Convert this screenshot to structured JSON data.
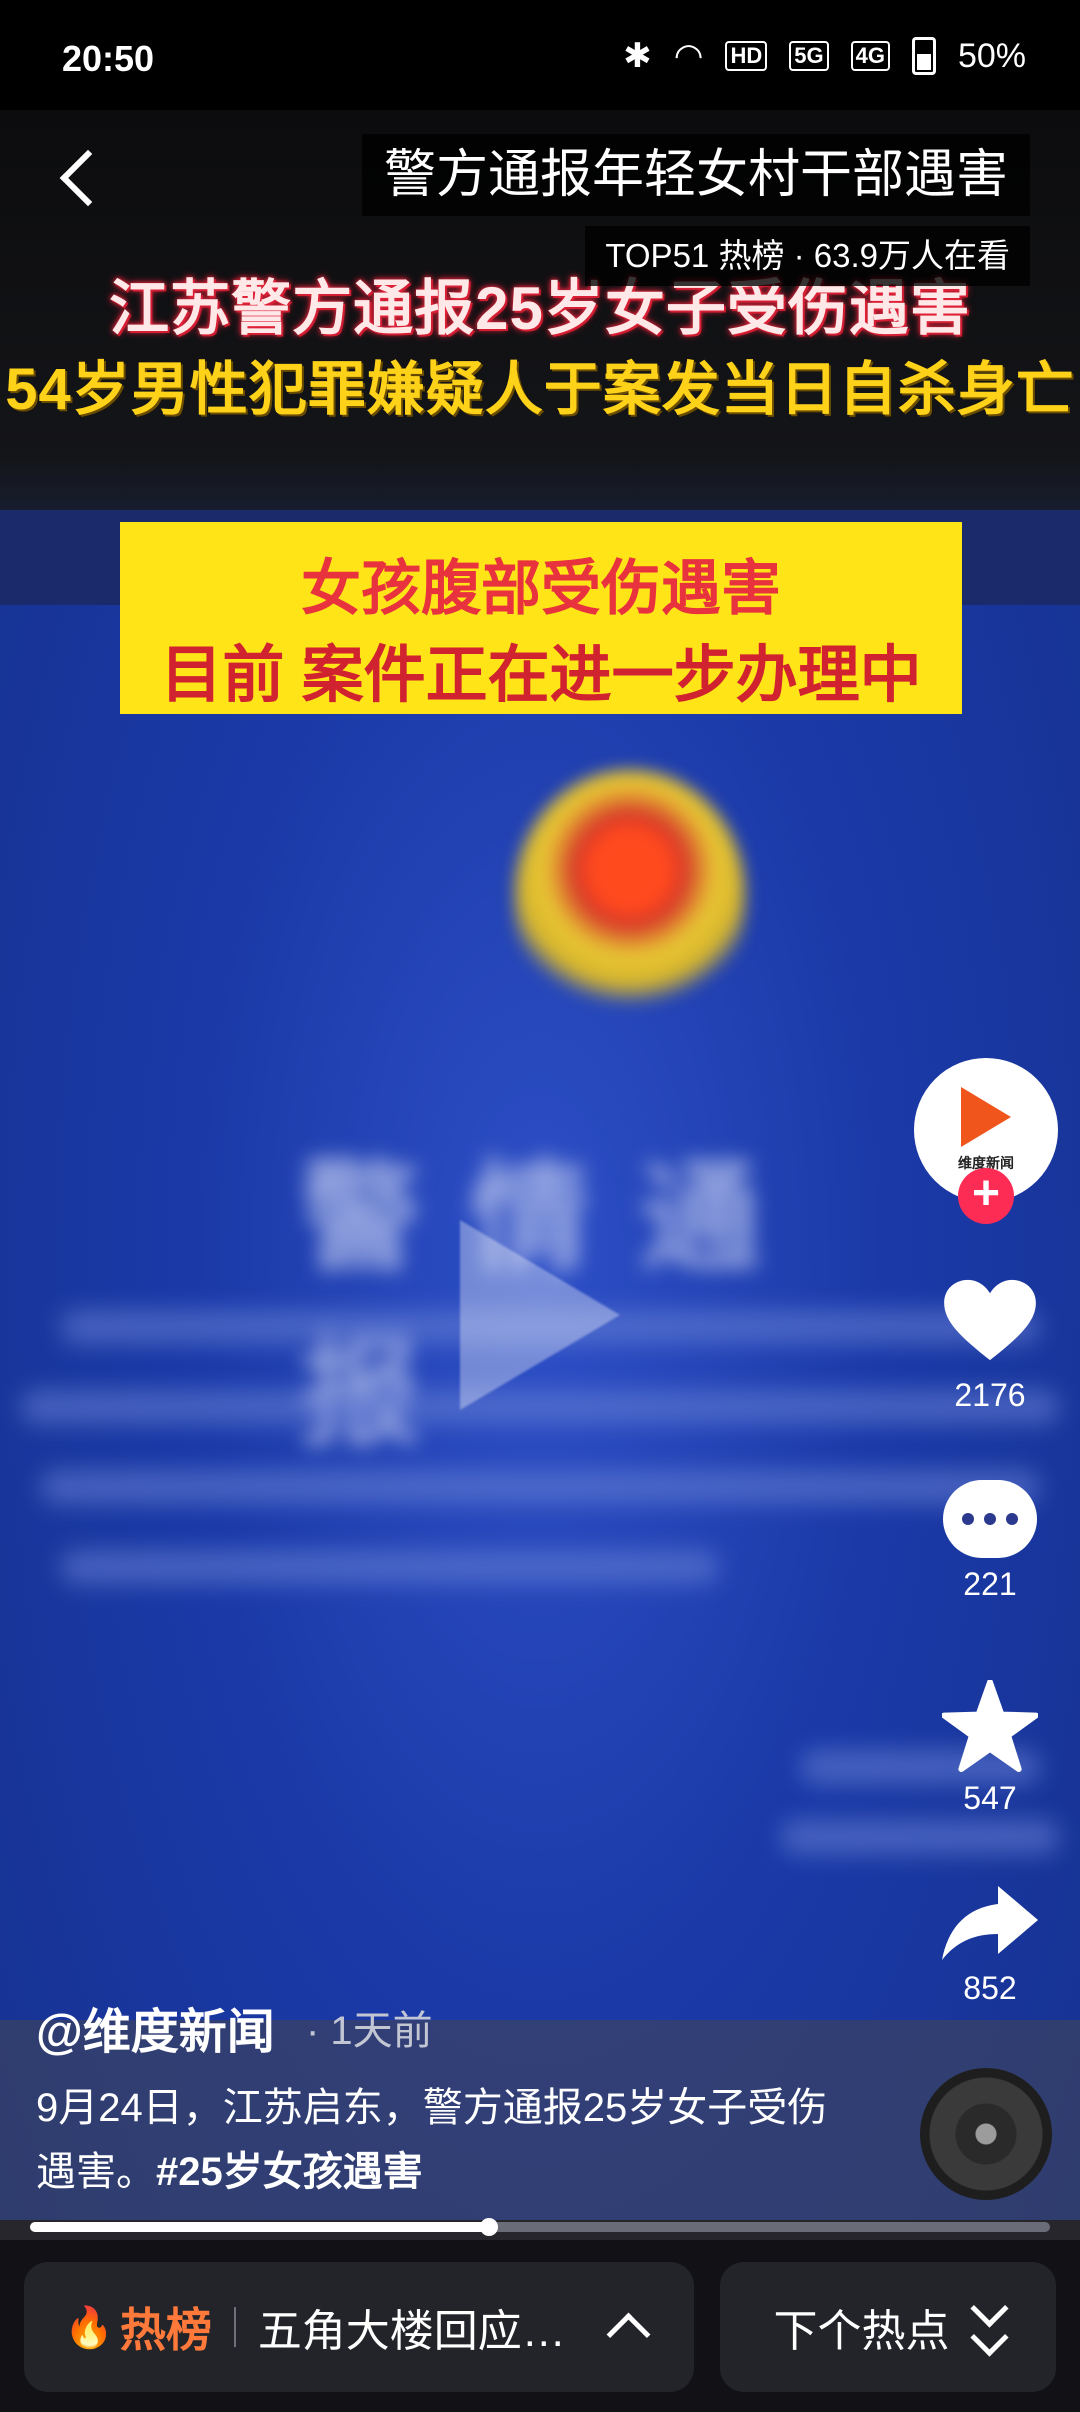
{
  "status_bar": {
    "time": "20:50",
    "battery": "50%",
    "hd_label": "HD",
    "signal_5g": "5G",
    "signal_4g": "4G"
  },
  "header": {
    "title": "警方通报年轻女村干部遇害",
    "rank": "TOP51 热榜 · 63.9万人在看"
  },
  "video": {
    "headline_line1": "江苏警方通报25岁女子受伤遇害",
    "headline_line2": "54岁男性犯罪嫌疑人于案发当日自杀身亡",
    "box_line1": "女孩腹部受伤遇害",
    "box_line2": "目前 案件正在进一步办理中",
    "blurred_title": "警情通报",
    "progress": 0.45
  },
  "side_actions": {
    "avatar_text": "维度新闻",
    "follow": "+",
    "likes": "2176",
    "comments": "221",
    "favorites": "547",
    "shares": "852"
  },
  "post": {
    "author": "@维度新闻",
    "time_ago": "· 1天前",
    "description": "9月24日，江苏启东，警方通报25岁女子受伤遇害。",
    "hashtag": "#25岁女孩遇害"
  },
  "bottom_bar": {
    "hot_label": "热榜",
    "hot_topic": "五角大楼回应…",
    "next_label": "下个热点"
  },
  "colors": {
    "accent": "#fd2c55",
    "hot": "#ff7a3a",
    "video_bg": "#1b3aa8",
    "caption_box": "#ffe418"
  },
  "icons": [
    "back-icon",
    "bluetooth-icon",
    "wifi-icon",
    "battery-icon",
    "heart-icon",
    "comment-icon",
    "star-icon",
    "share-icon",
    "flame-icon",
    "chevron-up-icon",
    "double-chevron-down-icon",
    "music-disc-icon"
  ]
}
